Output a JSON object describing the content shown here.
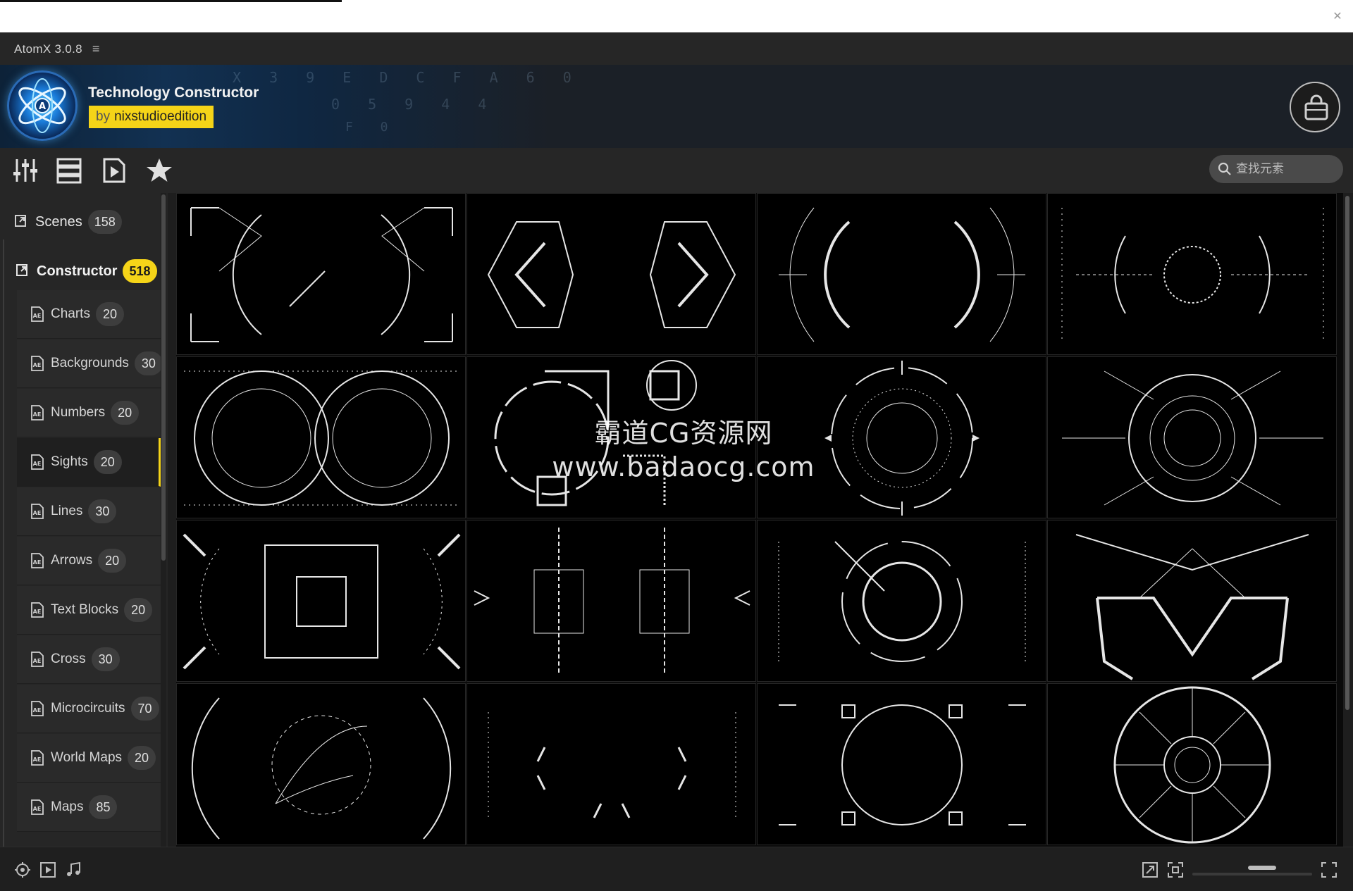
{
  "app": {
    "title": "AtomX 3.0.8"
  },
  "banner": {
    "title": "Technology Constructor",
    "author_prefix": "by",
    "author": "nixstudioedition"
  },
  "search": {
    "placeholder": "查找元素"
  },
  "sidebar": {
    "sections": [
      {
        "label": "Scenes",
        "count": "158"
      },
      {
        "label": "Constructor",
        "count": "518"
      }
    ],
    "items": [
      {
        "label": "Charts",
        "count": "20"
      },
      {
        "label": "Backgrounds",
        "count": "30"
      },
      {
        "label": "Numbers",
        "count": "20"
      },
      {
        "label": "Sights",
        "count": "20",
        "active": true
      },
      {
        "label": "Lines",
        "count": "30"
      },
      {
        "label": "Arrows",
        "count": "20"
      },
      {
        "label": "Text Blocks",
        "count": "20"
      },
      {
        "label": "Cross",
        "count": "30"
      },
      {
        "label": "Microcircuits",
        "count": "70"
      },
      {
        "label": "World Maps",
        "count": "20"
      },
      {
        "label": "Maps",
        "count": "85"
      }
    ]
  },
  "watermark": {
    "line1": "霸道CG资源网",
    "line2": "www.badaocg.com"
  },
  "colors": {
    "accent": "#f5d418",
    "panel": "#262626",
    "gallery_bg": "#000000"
  },
  "icons": {
    "toolbar": [
      "sliders-icon",
      "list-icon",
      "play-file-icon",
      "star-icon"
    ],
    "bottom": [
      "target-icon",
      "preview-icon",
      "music-icon",
      "expand-icon",
      "fullscreen-icon",
      "fit-icon"
    ]
  }
}
